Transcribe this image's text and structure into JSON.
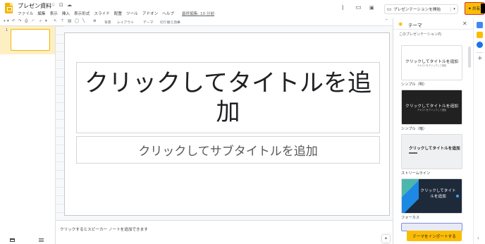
{
  "header": {
    "doc_title": "プレゼン資料",
    "menu": [
      "ファイル",
      "編集",
      "表示",
      "挿入",
      "表示形式",
      "スライド",
      "配置",
      "ツール",
      "アドオン",
      "ヘルプ"
    ],
    "last_edit": "最終編集: 10 分前",
    "present_label": "プレゼンテーションを開始",
    "share_label": "共有"
  },
  "toolbar": {
    "background_label": "背景",
    "layout_label": "レイアウト",
    "theme_label": "テーマ",
    "transition_label": "切り替え効果"
  },
  "filmstrip": {
    "slide_number": "1"
  },
  "slide": {
    "title": "クリックしてタイトルを追加",
    "subtitle": "クリックしてサブタイトルを追加"
  },
  "notes": {
    "placeholder": "クリックするとスピーカー ノートを追加できます"
  },
  "theme_panel": {
    "title": "テーマ",
    "section_label": "このプレゼンテーション内",
    "themes": [
      {
        "name": "シンプル（明）",
        "card_title": "クリックしてタイトルを追加",
        "card_sub": "テキストをクリックして追加"
      },
      {
        "name": "シンプル（暗）",
        "card_title": "クリックしてタイトルを追加",
        "card_sub": "テキストをクリックして追加"
      },
      {
        "name": "ストリームライン",
        "card_title": "クリックしてタイトルを追加",
        "card_sub": ""
      },
      {
        "name": "フォーカス",
        "card_title": "クリックしてタイトルを追加",
        "card_sub": ""
      }
    ],
    "import_label": "テーマをインポートする"
  },
  "colors": {
    "accent": "#fbbc04",
    "slides_logo": "#f4b400",
    "share_border": "#d32f2f"
  },
  "icons": [
    "star-icon",
    "move-to-folder-icon",
    "cloud-status-icon",
    "activity-trend-icon",
    "comment-icon",
    "present-icon",
    "lock-icon",
    "palette-icon",
    "close-icon",
    "calendar-icon",
    "keep-icon",
    "tasks-icon",
    "plus-icon",
    "explore-icon",
    "grid-view-icon",
    "filmstrip-view-icon"
  ]
}
